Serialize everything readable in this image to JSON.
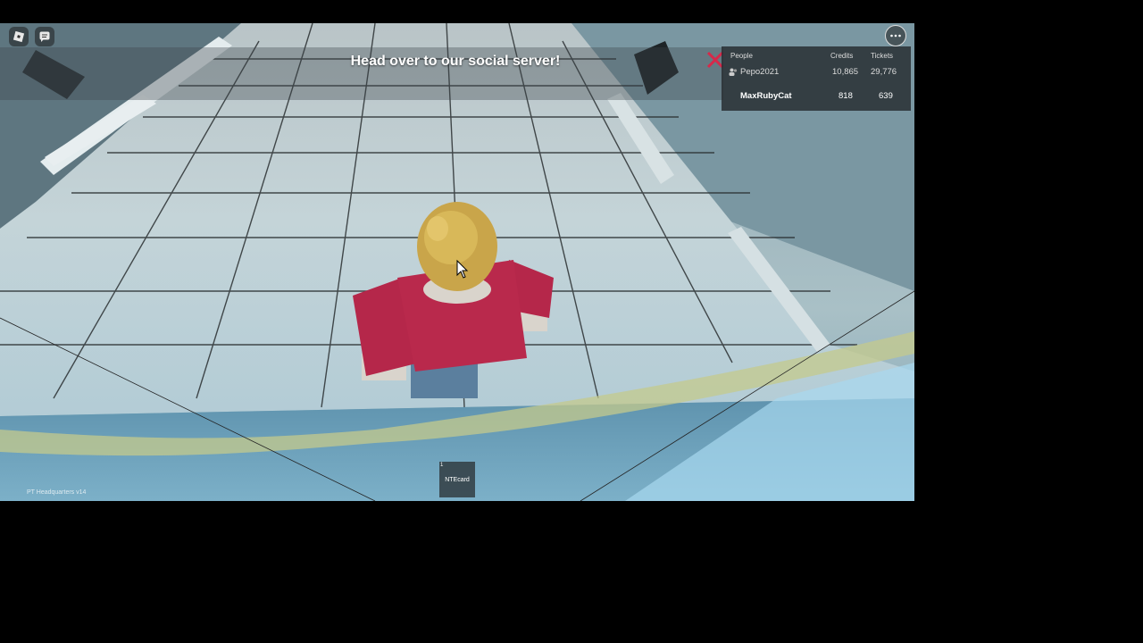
{
  "announcement": "Head over to our social server!",
  "leaderboard": {
    "headers": {
      "people": "People",
      "credits": "Credits",
      "tickets": "Tickets"
    },
    "rows": [
      {
        "name": "Pepo2021",
        "credits": "10,865",
        "tickets": "29,776"
      },
      {
        "name": "MaxRubyCat",
        "credits": "818",
        "tickets": "639"
      }
    ]
  },
  "hotbar": {
    "slot_number": "1",
    "item": "NTEcard"
  },
  "version_text": "PT Headquarters v14",
  "icons": {
    "menu": "roblox-logo-icon",
    "chat": "chat-icon",
    "more": "more-options-icon",
    "close": "close-icon",
    "people": "people-icon"
  },
  "colors": {
    "close_red": "#d8284a",
    "shirt": "#b5274a",
    "hair": "#c9a54a"
  }
}
